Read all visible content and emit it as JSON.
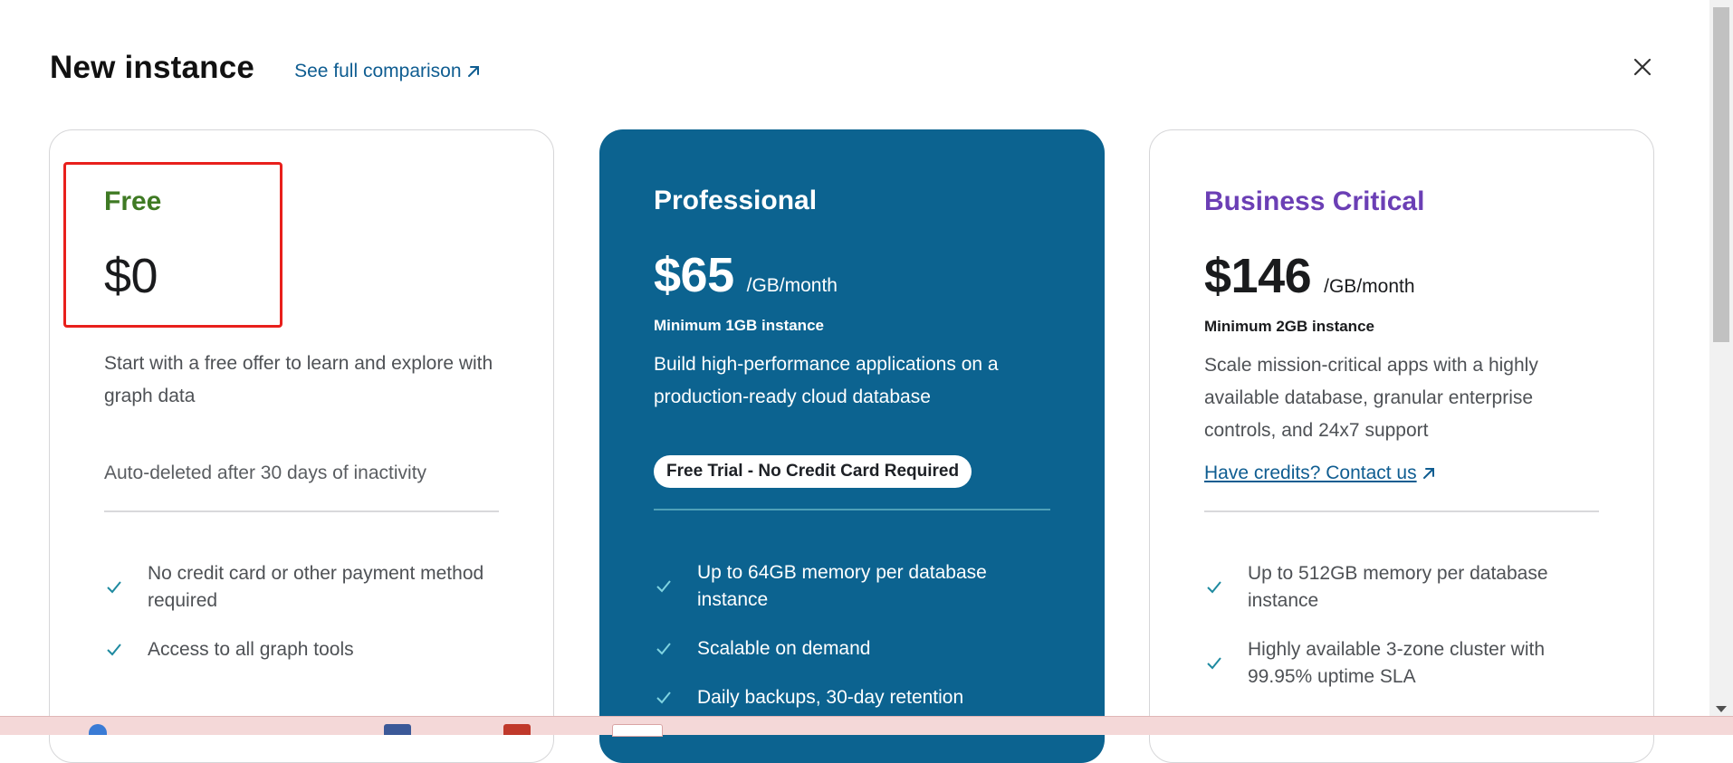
{
  "header": {
    "title": "New instance",
    "compare_link": "See full comparison"
  },
  "icons": {
    "close": "close-icon",
    "external": "external-link-arrow-icon",
    "check": "check-icon"
  },
  "colors": {
    "primary_dark": "#0c6390",
    "link": "#0f5d91",
    "free_accent": "#3f7a24",
    "business_accent": "#6b3fb5",
    "check_teal": "#1e8aa0",
    "highlight": "#e8201c"
  },
  "plans": [
    {
      "name": "Free",
      "price": "$0",
      "description": "Start with a free offer to learn and explore with graph data",
      "note": "Auto-deleted after 30 days of inactivity",
      "features": [
        "No credit card or other payment method required",
        "Access to all graph tools"
      ]
    },
    {
      "name": "Professional",
      "price": "$65",
      "unit": "/GB/month",
      "minimum": "Minimum 1GB instance",
      "description": "Build high-performance applications on a production-ready cloud database",
      "badge": "Free Trial - No Credit Card Required",
      "features": [
        "Up to 64GB memory per database instance",
        "Scalable on demand",
        "Daily backups, 30-day retention"
      ]
    },
    {
      "name": "Business Critical",
      "price": "$146",
      "unit": "/GB/month",
      "minimum": "Minimum 2GB instance",
      "description": "Scale mission-critical apps with a highly available database, granular enterprise controls, and 24x7 support",
      "contact_link": "Have credits? Contact us",
      "features": [
        "Up to 512GB memory per database instance",
        "Highly available 3-zone cluster with 99.95% uptime SLA"
      ]
    }
  ]
}
